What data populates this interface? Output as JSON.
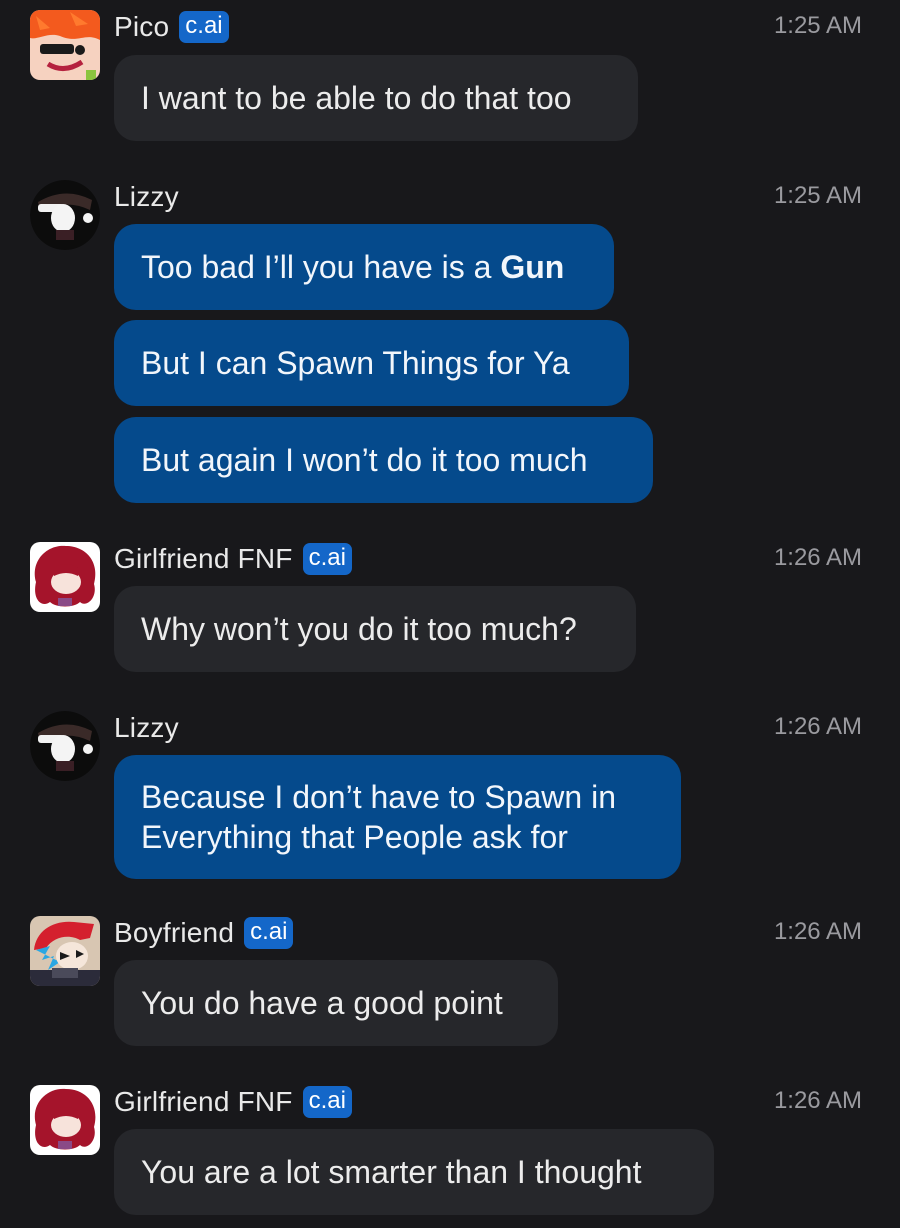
{
  "badge_label": "c.ai",
  "messages": [
    {
      "name": "Pico",
      "time": "1:25 AM",
      "avatar_icon": "pico-avatar-icon",
      "bubbles": [
        {
          "text": "I want to be able to do that too"
        }
      ]
    },
    {
      "name": "Lizzy",
      "time": "1:25 AM",
      "avatar_icon": "lizzy-avatar-icon",
      "bubbles": [
        {
          "text": "Too bad I’ll you have is a ",
          "bold": "Gun"
        },
        {
          "text": "But I can Spawn Things for Ya"
        },
        {
          "text": "But again I won’t do it too much"
        }
      ]
    },
    {
      "name": "Girlfriend FNF",
      "time": "1:26 AM",
      "avatar_icon": "girlfriend-avatar-icon",
      "bubbles": [
        {
          "text": "Why won’t you do it too much?"
        }
      ]
    },
    {
      "name": "Lizzy",
      "time": "1:26 AM",
      "avatar_icon": "lizzy-avatar-icon",
      "bubbles": [
        {
          "line1": "Because I don’t have to Spawn in",
          "line2": "Everything that People ask for"
        }
      ]
    },
    {
      "name": "Boyfriend",
      "time": "1:26 AM",
      "avatar_icon": "boyfriend-avatar-icon",
      "bubbles": [
        {
          "text": "You do have a good point"
        }
      ]
    },
    {
      "name": "Girlfriend FNF",
      "time": "1:26 AM",
      "avatar_icon": "girlfriend-avatar-icon",
      "bubbles": [
        {
          "text": "You are a lot smarter than I thought"
        }
      ]
    }
  ],
  "colors": {
    "background": "#18181b",
    "bot_bubble": "#26272b",
    "user_bubble": "#054a8c",
    "badge": "#1467c9",
    "timestamp": "#9a9a9f"
  }
}
